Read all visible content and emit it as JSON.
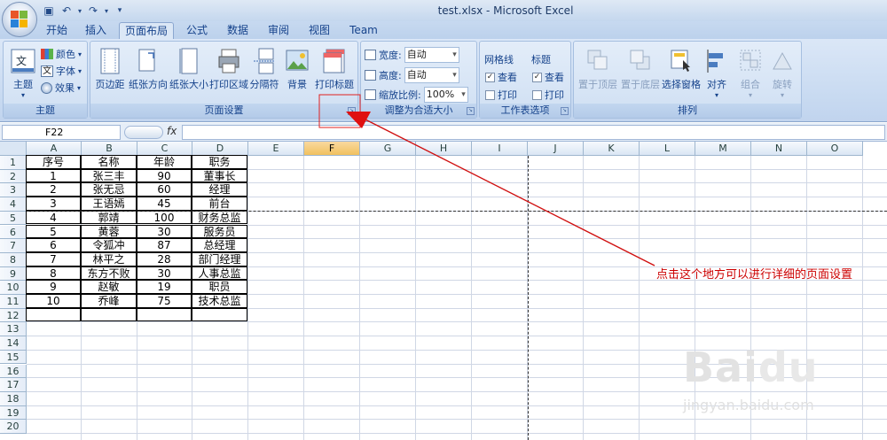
{
  "window": {
    "title": "test.xlsx - Microsoft Excel"
  },
  "tabs": [
    "开始",
    "插入",
    "页面布局",
    "公式",
    "数据",
    "审阅",
    "视图",
    "Team"
  ],
  "active_tab": "页面布局",
  "ribbon": {
    "theme_group": {
      "label": "主题",
      "theme_btn": "主题",
      "colors": "颜色",
      "fonts": "字体",
      "effects": "效果"
    },
    "page_setup_group": {
      "label": "页面设置",
      "margins": "页边距",
      "orientation": "纸张方向",
      "size": "纸张大小",
      "print_area": "打印区域",
      "breaks": "分隔符",
      "background": "背景",
      "print_titles": "打印标题"
    },
    "scale_group": {
      "label": "调整为合适大小",
      "width_label": "宽度:",
      "width_value": "自动",
      "height_label": "高度:",
      "height_value": "自动",
      "scale_label": "缩放比例:",
      "scale_value": "100%"
    },
    "sheet_options_group": {
      "label": "工作表选项",
      "gridlines": "网格线",
      "headings": "标题",
      "view": "查看",
      "print": "打印"
    },
    "arrange_group": {
      "label": "排列",
      "bring_forward": "置于顶层",
      "send_backward": "置于底层",
      "selection_pane": "选择窗格",
      "align": "对齐",
      "group": "组合",
      "rotate": "旋转"
    }
  },
  "formula_bar": {
    "name_box": "F22",
    "fx": "fx",
    "formula": ""
  },
  "columns": [
    "A",
    "B",
    "C",
    "D",
    "E",
    "F",
    "G",
    "H",
    "I",
    "J",
    "K",
    "L",
    "M",
    "N",
    "O"
  ],
  "selected_column": "F",
  "rows": [
    "1",
    "2",
    "3",
    "4",
    "5",
    "6",
    "7",
    "8",
    "9",
    "10",
    "11",
    "12",
    "13",
    "14",
    "15",
    "16",
    "17",
    "18",
    "19",
    "20"
  ],
  "table": {
    "headers": [
      "序号",
      "名称",
      "年龄",
      "职务"
    ],
    "rows": [
      [
        "1",
        "张三丰",
        "90",
        "董事长"
      ],
      [
        "2",
        "张无忌",
        "60",
        "经理"
      ],
      [
        "3",
        "王语嫣",
        "45",
        "前台"
      ],
      [
        "4",
        "郭靖",
        "100",
        "财务总监"
      ],
      [
        "5",
        "黄蓉",
        "30",
        "服务员"
      ],
      [
        "6",
        "令狐冲",
        "87",
        "总经理"
      ],
      [
        "7",
        "林平之",
        "28",
        "部门经理"
      ],
      [
        "8",
        "东方不败",
        "30",
        "人事总监"
      ],
      [
        "9",
        "赵敏",
        "19",
        "职员"
      ],
      [
        "10",
        "乔峰",
        "75",
        "技术总监"
      ]
    ]
  },
  "annotation": "点击这个地方可以进行详细的页面设置",
  "watermark": {
    "logo": "Baidu经验",
    "url": "jingyan.baidu.com"
  },
  "colors": {
    "annotation": "#cc0000",
    "ribbon": "#c8daf1",
    "selected_header": "#f1c15f"
  }
}
